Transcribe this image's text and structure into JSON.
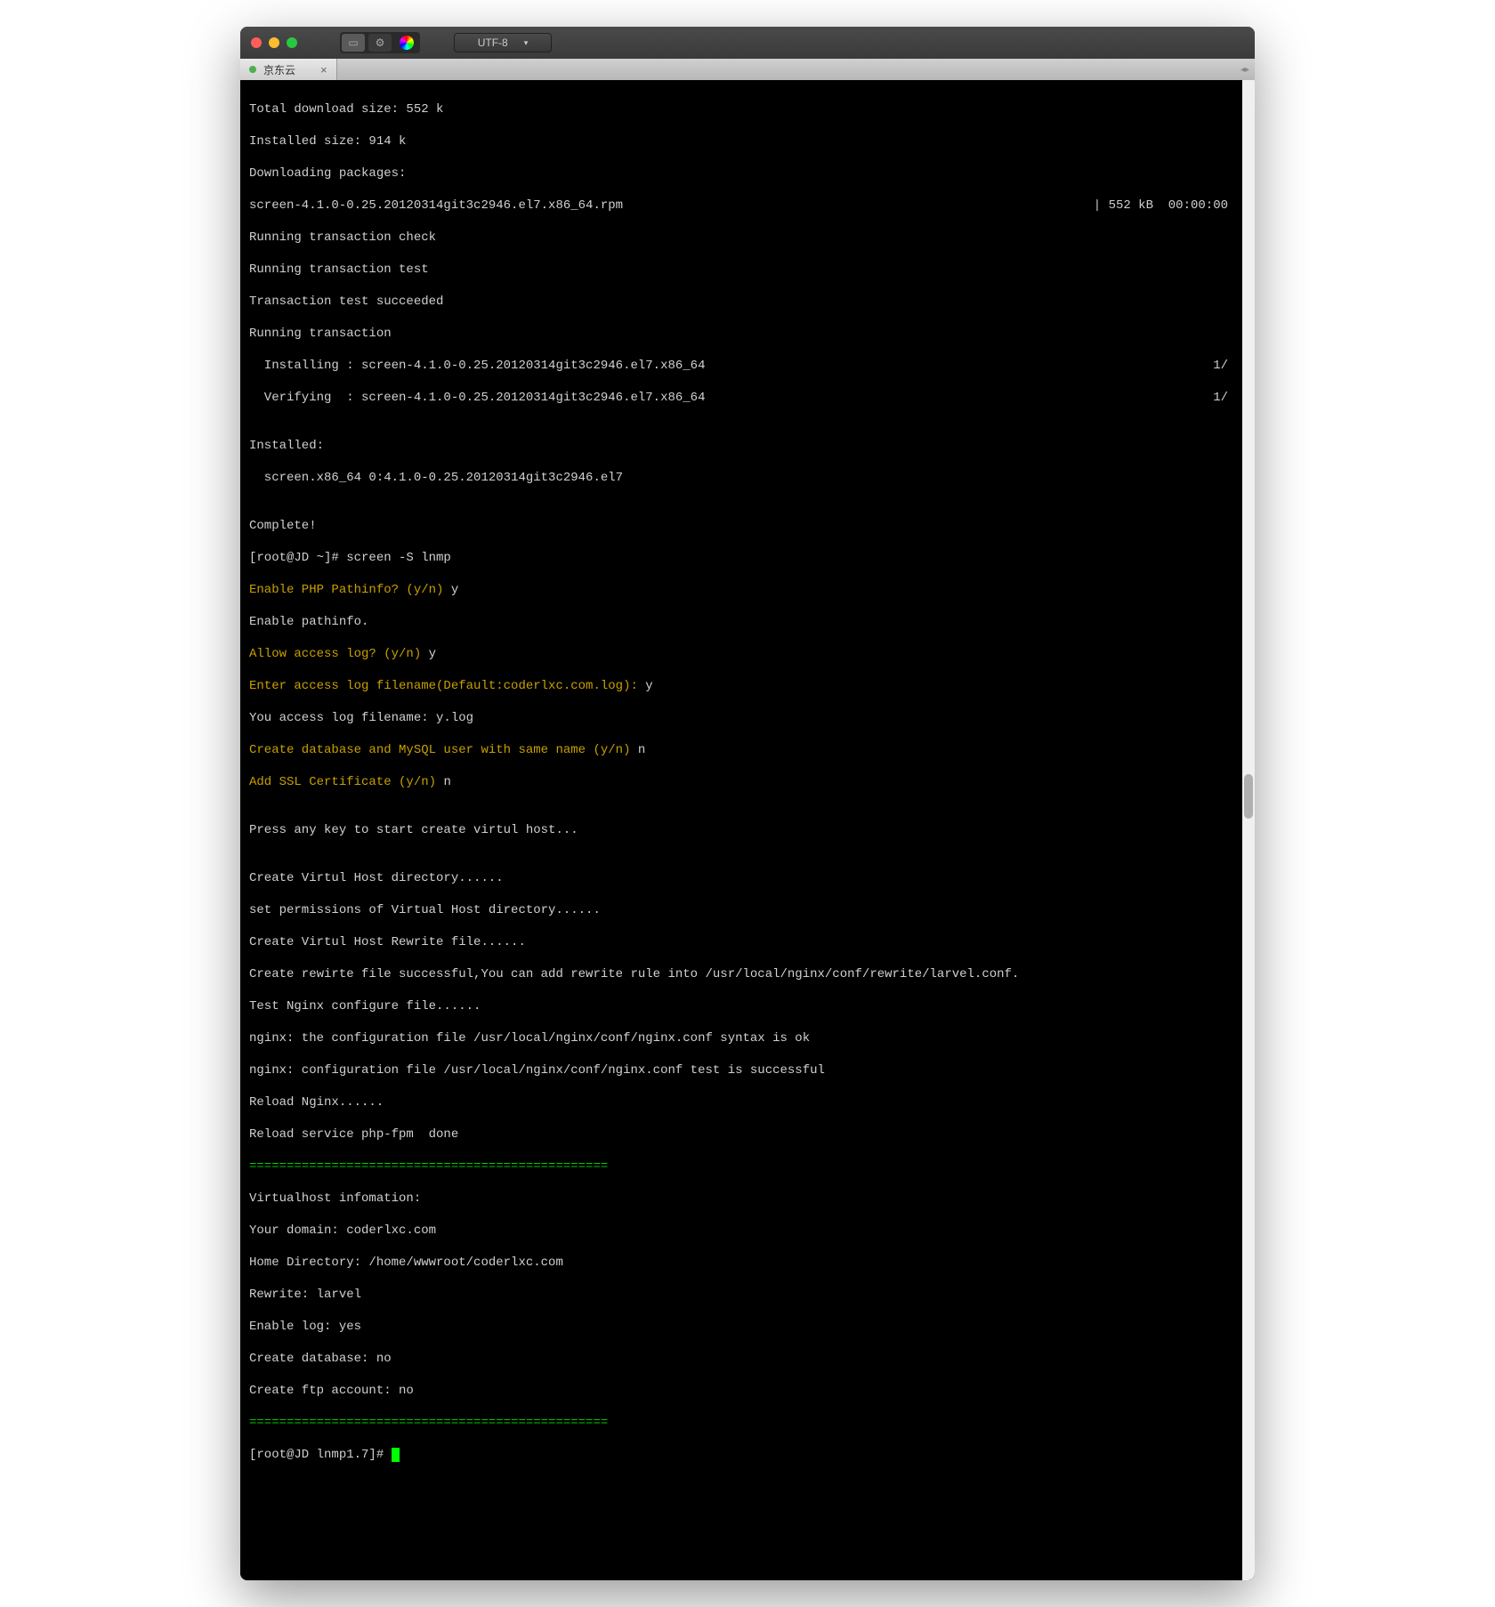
{
  "titlebar": {
    "encoding": "UTF-8"
  },
  "tab": {
    "label": "京东云"
  },
  "term": {
    "l1": "Total download size: 552 k",
    "l2": "Installed size: 914 k",
    "l3": "Downloading packages:",
    "l4_left": "screen-4.1.0-0.25.20120314git3c2946.el7.x86_64.rpm",
    "l4_right": "| 552 kB  00:00:00",
    "l5": "Running transaction check",
    "l6": "Running transaction test",
    "l7": "Transaction test succeeded",
    "l8": "Running transaction",
    "l9_left": "  Installing : screen-4.1.0-0.25.20120314git3c2946.el7.x86_64",
    "l9_right": "1/",
    "l10_left": "  Verifying  : screen-4.1.0-0.25.20120314git3c2946.el7.x86_64",
    "l10_right": "1/",
    "l11": "",
    "l12": "Installed:",
    "l13": "  screen.x86_64 0:4.1.0-0.25.20120314git3c2946.el7",
    "l14": "",
    "l15": "Complete!",
    "l16": "[root@JD ~]# screen -S lnmp",
    "l17_y": "Enable PHP Pathinfo? (y/n) ",
    "l17_a": "y",
    "l18": "Enable pathinfo.",
    "l19_y": "Allow access log? (y/n) ",
    "l19_a": "y",
    "l20_y": "Enter access log filename(Default:coderlxc.com.log): ",
    "l20_a": "y",
    "l21": "You access log filename: y.log",
    "l22_y": "Create database and MySQL user with same name (y/n) ",
    "l22_a": "n",
    "l23_y": "Add SSL Certificate (y/n) ",
    "l23_a": "n",
    "l24": "",
    "l25": "Press any key to start create virtul host...",
    "l26": "",
    "l27": "Create Virtul Host directory......",
    "l28": "set permissions of Virtual Host directory......",
    "l29": "Create Virtul Host Rewrite file......",
    "l30": "Create rewirte file successful,You can add rewrite rule into /usr/local/nginx/conf/rewrite/larvel.conf.",
    "l31": "Test Nginx configure file......",
    "l32": "nginx: the configuration file /usr/local/nginx/conf/nginx.conf syntax is ok",
    "l33": "nginx: configuration file /usr/local/nginx/conf/nginx.conf test is successful",
    "l34": "Reload Nginx......",
    "l35": "Reload service php-fpm  done",
    "sep1": "================================================",
    "l36": "Virtualhost infomation:",
    "l37": "Your domain: coderlxc.com",
    "l38": "Home Directory: /home/wwwroot/coderlxc.com",
    "l39": "Rewrite: larvel",
    "l40": "Enable log: yes",
    "l41": "Create database: no",
    "l42": "Create ftp account: no",
    "sep2": "================================================",
    "prompt": "[root@JD lnmp1.7]# "
  }
}
